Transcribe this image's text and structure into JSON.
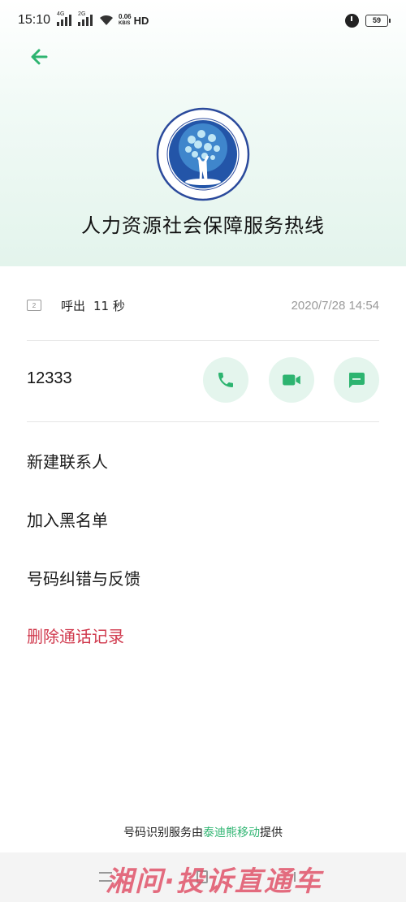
{
  "status_bar": {
    "time": "15:10",
    "signal1_label": "4G",
    "signal2_label": "2G",
    "speed_value": "0.06",
    "speed_unit": "KB/S",
    "hd_label": "HD",
    "battery": "59"
  },
  "contact": {
    "name": "人力资源社会保障服务热线",
    "number": "12333",
    "logo_icon": "chongqing-labor-social-security-logo"
  },
  "call_record": {
    "sim": "2",
    "type": "呼出",
    "duration": "11 秒",
    "datetime": "2020/7/28 14:54"
  },
  "actions": {
    "call_icon": "phone-icon",
    "video_icon": "video-camera-icon",
    "message_icon": "message-icon"
  },
  "menu": {
    "new_contact": "新建联系人",
    "blacklist": "加入黑名单",
    "feedback": "号码纠错与反馈",
    "delete": "删除通话记录"
  },
  "footer": {
    "prefix": "号码识别服务由",
    "brand": "泰迪熊移动",
    "suffix": "提供"
  },
  "watermark": "湘问·投诉直通车",
  "colors": {
    "accent": "#2db470",
    "action_bg": "#e4f5ed",
    "danger": "#d0394d"
  }
}
